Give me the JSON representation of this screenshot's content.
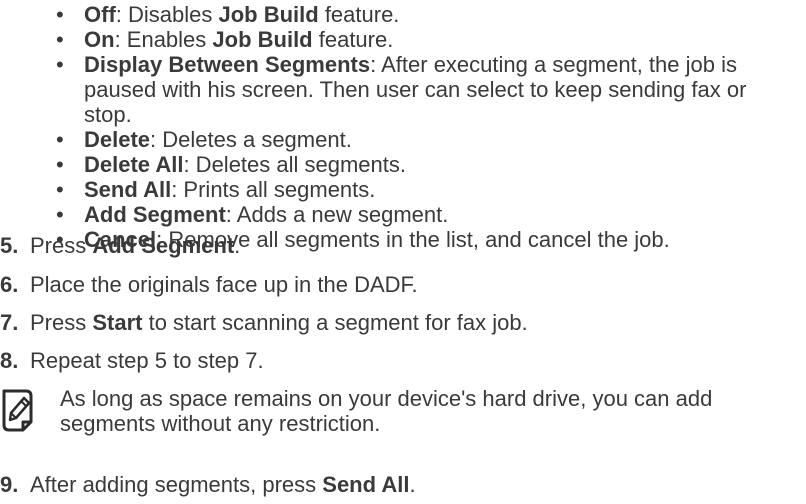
{
  "bullets": [
    {
      "term": "Off",
      "desc": ": Disables ",
      "term2": "Job Build",
      "desc2": " feature."
    },
    {
      "term": "On",
      "desc": ": Enables ",
      "term2": "Job Build",
      "desc2": " feature."
    },
    {
      "term": "Display Between Segments",
      "desc": ": After executing a segment, the job is paused with his screen. Then user can select to keep sending fax or stop."
    },
    {
      "term": "Delete",
      "desc": ": Deletes a segment."
    },
    {
      "term": "Delete All",
      "desc": ": Deletes all segments."
    },
    {
      "term": "Send All",
      "desc": ": Prints all segments."
    },
    {
      "term": "Add Segment",
      "desc": ": Adds a new segment."
    },
    {
      "term": "Cancel",
      "desc": ": Remove all segments in the list, and cancel the job."
    }
  ],
  "bullet_symbol": "•",
  "steps": {
    "s5": {
      "num": "5.",
      "pre": "Press ",
      "bold": "Add Segment",
      "post": "."
    },
    "s6": {
      "num": "6.",
      "text": "Place the originals face up in the DADF."
    },
    "s7": {
      "num": "7.",
      "pre": "Press ",
      "bold": "Start",
      "post": " to start scanning a segment for fax job."
    },
    "s8": {
      "num": "8.",
      "text": "Repeat step 5 to step 7."
    },
    "s9": {
      "num": "9.",
      "pre": "After adding segments, press ",
      "bold": "Send All",
      "post": "."
    }
  },
  "note": {
    "icon": "note-pencil-icon",
    "text": "As long as space remains on your device's hard drive, you can add segments without any restriction."
  }
}
